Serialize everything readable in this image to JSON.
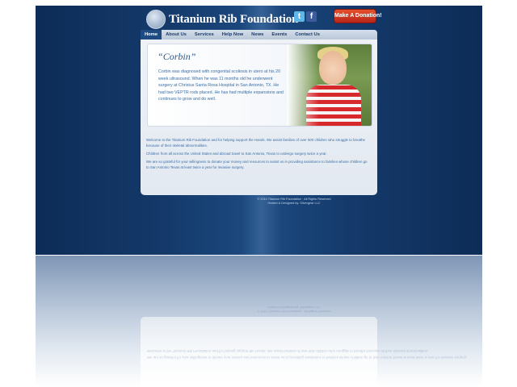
{
  "site": {
    "logo_text": "Titanium Rib Foundation",
    "donate_label": "Make A Donation!",
    "social": [
      "twitter-icon",
      "facebook-icon"
    ]
  },
  "nav": {
    "items": [
      {
        "label": "Home",
        "active": true
      },
      {
        "label": "About Us"
      },
      {
        "label": "Services"
      },
      {
        "label": "Help Now"
      },
      {
        "label": "News"
      },
      {
        "label": "Events"
      },
      {
        "label": "Contact Us"
      }
    ]
  },
  "feature": {
    "name": "Corbin",
    "text": "Corbin was diagnosed with congenital scoliosis in utero at his 20 week ultrasound. When he was 11 months old he underwent surgery at Christus Santa Rosa Hospital in San Antonio, TX. He had two VEPTR rods placed. He has had multiple expansions and continues to grow and do well."
  },
  "body": {
    "paragraphs": [
      "Welcome to the Titanium Rib Foundation and for helping support the Hands. We assist families of over 500 children who struggle to breathe because of their skeletal abnormalities.",
      "Children from all across the United States and abroad travel to San Antonio, Texas to undergo surgery twice a year.",
      "We are so grateful for your willingness to donate your money and resources to assist us in providing assistance to families whose children go to San Antonio Texas at least twice a year for invasive surgery."
    ]
  },
  "footer": {
    "copyright": "© 2010 Titanium Rib Foundation · All Rights Reserved",
    "credit": "Hosted & Designed by: Silvergear LLC"
  },
  "colors": {
    "background": "#143a6b",
    "nav_active": "#1d4b82",
    "donate": "#d53a22",
    "text": "#3a6ea5"
  }
}
